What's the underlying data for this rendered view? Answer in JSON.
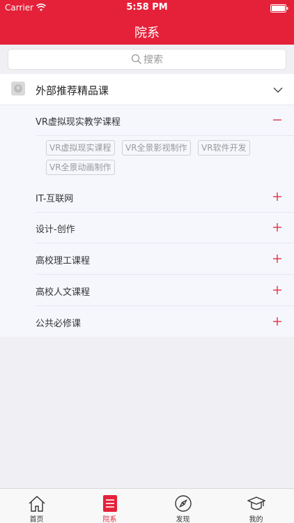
{
  "status_bar": {
    "carrier": "Carrier",
    "time": "5:58 PM"
  },
  "nav": {
    "title": "院系"
  },
  "search": {
    "placeholder": "搜索"
  },
  "category": {
    "title": "外部推荐精品课",
    "expanded": true
  },
  "sub_items": [
    {
      "label": "VR虚拟现实教学课程",
      "expanded": true
    },
    {
      "label": "IT-互联网",
      "expanded": false
    },
    {
      "label": "设计-创作",
      "expanded": false
    },
    {
      "label": "高校理工课程",
      "expanded": false
    },
    {
      "label": "高校人文课程",
      "expanded": false
    },
    {
      "label": "公共必修课",
      "expanded": false
    }
  ],
  "tags": [
    "VR虚拟现实课程",
    "VR全景影视制作",
    "VR软件开发",
    "VR全景动画制作"
  ],
  "tabbar": {
    "items": [
      {
        "label": "首页",
        "icon": "home-icon",
        "active": false
      },
      {
        "label": "院系",
        "icon": "list-icon",
        "active": true
      },
      {
        "label": "发现",
        "icon": "compass-icon",
        "active": false
      },
      {
        "label": "我的",
        "icon": "graduation-cap-icon",
        "active": false
      }
    ]
  },
  "colors": {
    "accent": "#e5213a",
    "background": "#efeff4",
    "sublist_bg": "#f5f7fd"
  }
}
